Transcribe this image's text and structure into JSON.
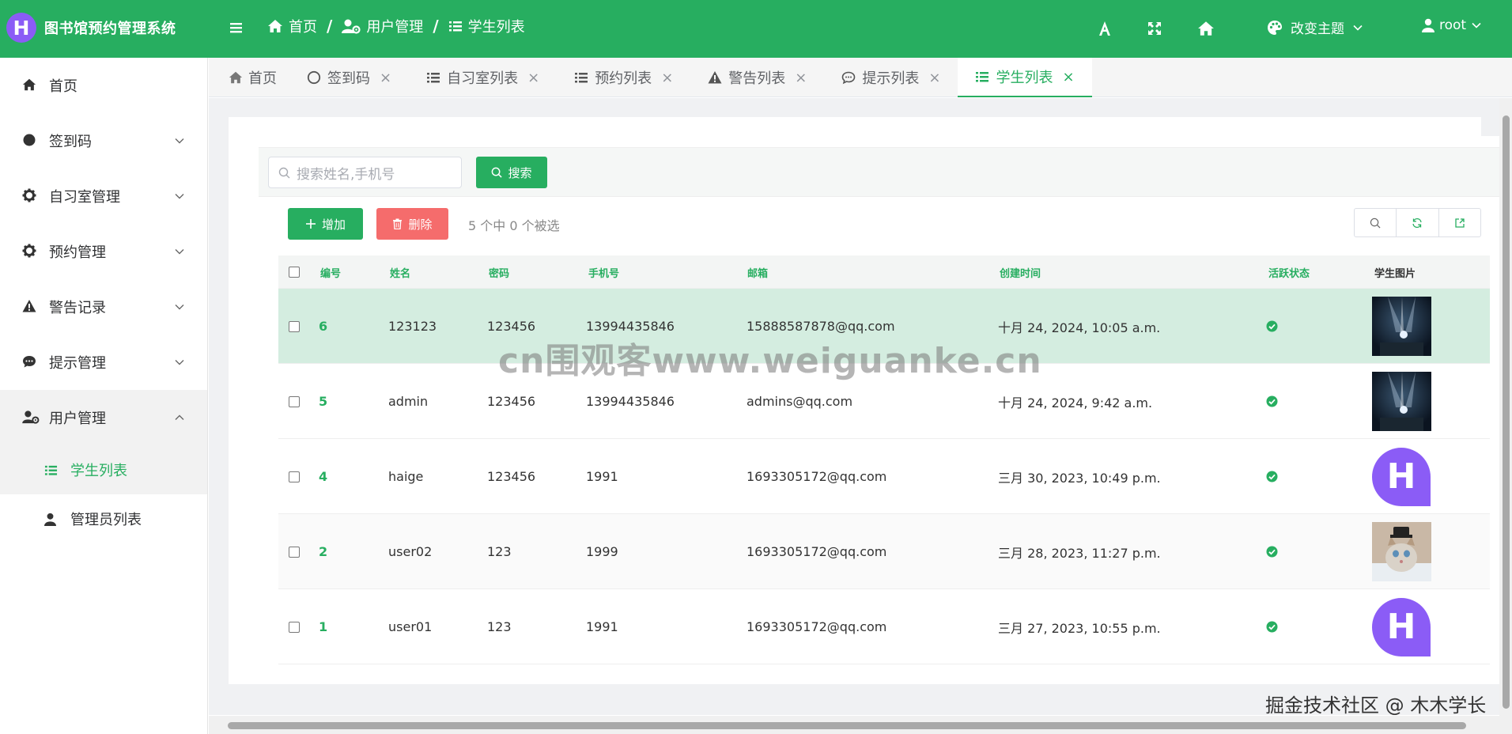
{
  "app": {
    "logo_letter": "H",
    "title": "图书馆预约管理系统",
    "brand_color": "#27ae60"
  },
  "breadcrumb": [
    {
      "label": "首页",
      "icon": "home-icon"
    },
    {
      "label": "用户管理",
      "icon": "user-cog-icon"
    },
    {
      "label": "学生列表",
      "icon": "list-icon"
    }
  ],
  "breadcrumb_separator": "/",
  "topbar": {
    "theme_label": "改变主题",
    "user_label": "root"
  },
  "sidebar": {
    "items": [
      {
        "label": "首页",
        "icon": "home-icon"
      },
      {
        "label": "签到码",
        "icon": "circle-icon"
      },
      {
        "label": "自习室管理",
        "icon": "gear-icon"
      },
      {
        "label": "预约管理",
        "icon": "gear-icon"
      },
      {
        "label": "警告记录",
        "icon": "warning-icon"
      },
      {
        "label": "提示管理",
        "icon": "comment-icon"
      },
      {
        "label": "用户管理",
        "icon": "user-cog-icon"
      }
    ],
    "sub_items": [
      {
        "label": "学生列表",
        "icon": "list-icon"
      },
      {
        "label": "管理员列表",
        "icon": "user-icon"
      }
    ]
  },
  "tabs": [
    {
      "label": "首页"
    },
    {
      "label": "签到码"
    },
    {
      "label": "自习室列表"
    },
    {
      "label": "预约列表"
    },
    {
      "label": "警告列表"
    },
    {
      "label": "提示列表"
    },
    {
      "label": "学生列表"
    }
  ],
  "tab_close": "×",
  "search": {
    "placeholder": "搜索姓名,手机号",
    "button_label": "搜索"
  },
  "actions": {
    "add_label": "增加",
    "delete_label": "删除",
    "selection_info": "5 个中 0 个被选"
  },
  "table": {
    "columns": [
      "编号",
      "姓名",
      "密码",
      "手机号",
      "邮箱",
      "创建时间",
      "活跃状态",
      "学生图片"
    ],
    "rows": [
      {
        "id": "6",
        "name": "123123",
        "password": "123456",
        "phone": "13994435846",
        "email": "15888587878@qq.com",
        "created": "十月 24, 2024, 10:05 a.m.",
        "active": true,
        "image": "concert-photo"
      },
      {
        "id": "5",
        "name": "admin",
        "password": "123456",
        "phone": "13994435846",
        "email": "admins@qq.com",
        "created": "十月 24, 2024, 9:42 a.m.",
        "active": true,
        "image": "concert-photo"
      },
      {
        "id": "4",
        "name": "haige",
        "password": "123456",
        "phone": "1991",
        "email": "1693305172@qq.com",
        "created": "三月 30, 2023, 10:49 p.m.",
        "active": true,
        "image": "h-avatar"
      },
      {
        "id": "2",
        "name": "user02",
        "password": "123",
        "phone": "1999",
        "email": "1693305172@qq.com",
        "created": "三月 28, 2023, 11:27 p.m.",
        "active": true,
        "image": "kitten-photo"
      },
      {
        "id": "1",
        "name": "user01",
        "password": "123",
        "phone": "1991",
        "email": "1693305172@qq.com",
        "created": "三月 27, 2023, 10:55 p.m.",
        "active": true,
        "image": "h-avatar"
      }
    ]
  },
  "watermark": "cn围观客www.weiguanke.cn",
  "corner_watermark": "掘金技术社区 @ 木木学长"
}
